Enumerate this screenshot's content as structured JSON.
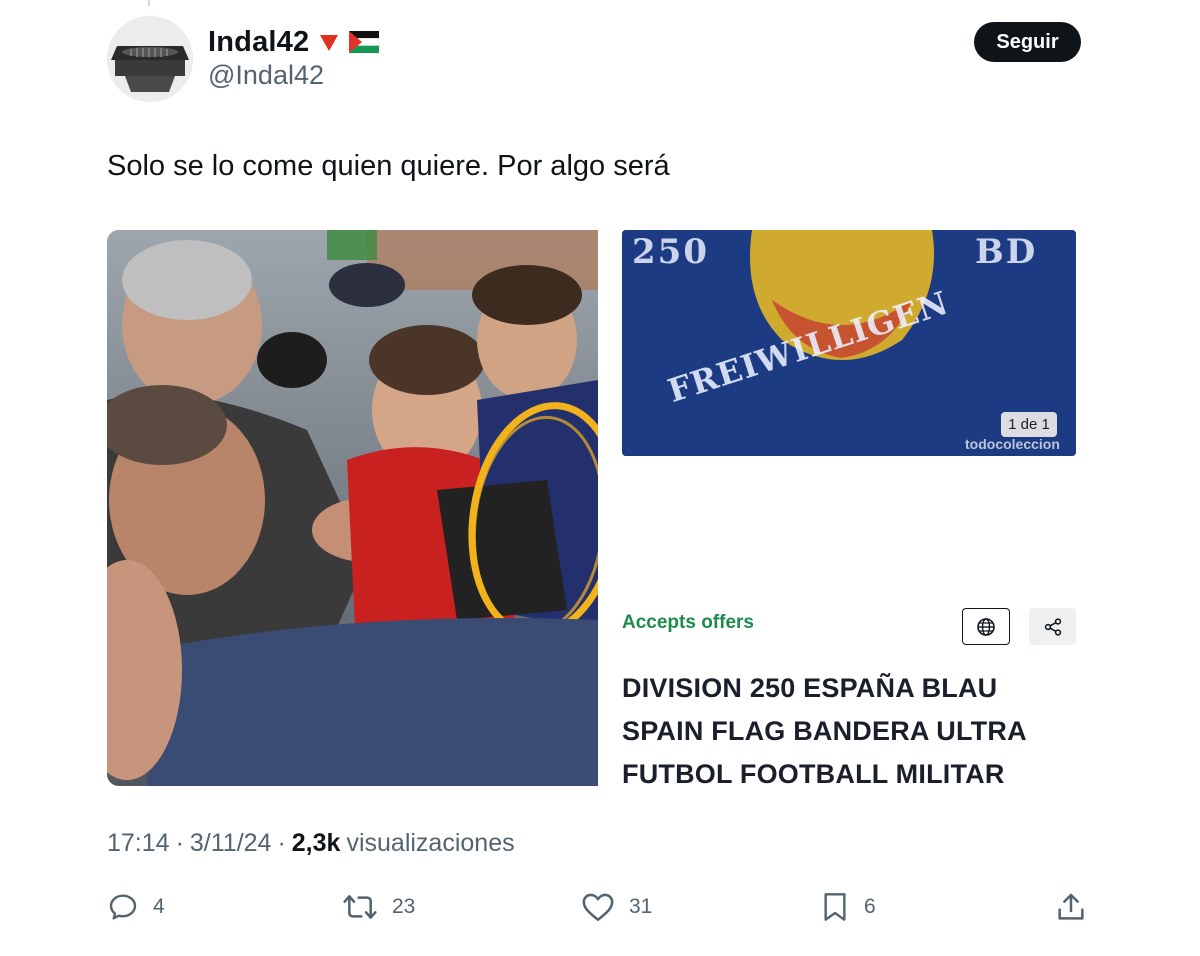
{
  "user": {
    "display_name": "Indal42",
    "handle": "@Indal42",
    "badges": [
      "down-red-triangle-emoji",
      "palestine-flag-emoji"
    ]
  },
  "follow_button": {
    "label": "Seguir"
  },
  "tweet": {
    "text": "Solo se lo come quien quiere. Por algo será"
  },
  "media": {
    "left_image": {
      "description_icon": "photo-crowd"
    },
    "right_image": {
      "banner_text_top_left": "250",
      "banner_text_top_right": "BD",
      "banner_text_main": "FREIWILLIGEN",
      "counter": "1 de 1",
      "watermark": "todocoleccion"
    },
    "listing": {
      "offers_label": "Accepts offers",
      "title": "DIVISION 250 ESPAÑA BLAU SPAIN FLAG BANDERA ULTRA FUTBOL FOOTBALL MILITAR",
      "globe_icon": "globe-icon",
      "share_icon": "share-icon"
    }
  },
  "meta": {
    "time": "17:14",
    "date": "3/11/24",
    "views_count": "2,3k",
    "views_label": "visualizaciones",
    "separator": "·"
  },
  "actions": {
    "replies": "4",
    "reposts": "23",
    "likes": "31",
    "bookmarks": "6"
  },
  "colors": {
    "accent_green": "#1e8a4e",
    "text_primary": "#0f1419",
    "text_secondary": "#536471",
    "follow_bg": "#0f1419"
  }
}
